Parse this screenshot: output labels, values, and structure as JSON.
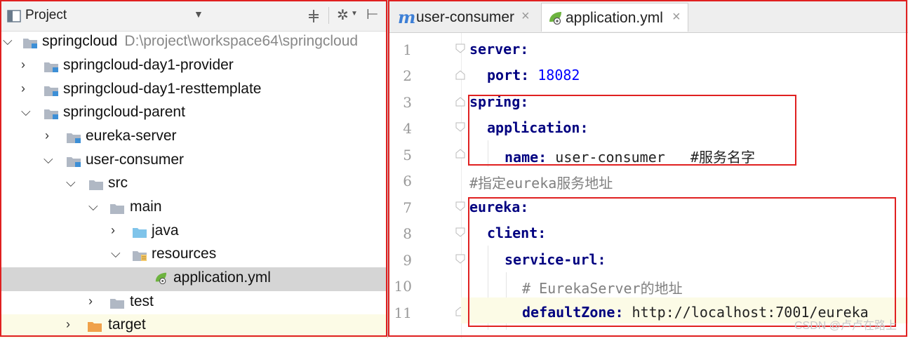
{
  "project_panel": {
    "title": "Project",
    "tree": [
      {
        "label": "springcloud",
        "path": "D:\\project\\workspace64\\springcloud",
        "expanded": true,
        "icon": "module-folder-icon"
      },
      {
        "label": "springcloud-day1-provider",
        "expanded": false,
        "icon": "module-folder-icon"
      },
      {
        "label": "springcloud-day1-resttemplate",
        "expanded": false,
        "icon": "module-folder-icon"
      },
      {
        "label": "springcloud-parent",
        "expanded": true,
        "icon": "module-folder-icon"
      },
      {
        "label": "eureka-server",
        "expanded": false,
        "icon": "module-folder-icon"
      },
      {
        "label": "user-consumer",
        "expanded": true,
        "icon": "module-folder-icon"
      },
      {
        "label": "src",
        "expanded": true,
        "icon": "folder-icon"
      },
      {
        "label": "main",
        "expanded": true,
        "icon": "folder-icon"
      },
      {
        "label": "java",
        "expanded": false,
        "icon": "source-folder-icon"
      },
      {
        "label": "resources",
        "expanded": true,
        "icon": "resources-folder-icon"
      },
      {
        "label": "application.yml",
        "selected": true,
        "icon": "spring-yml-icon"
      },
      {
        "label": "test",
        "expanded": false,
        "icon": "folder-icon"
      },
      {
        "label": "target",
        "expanded": false,
        "icon": "excluded-folder-icon"
      }
    ]
  },
  "editor": {
    "tabs": [
      {
        "label": "user-consumer",
        "icon": "m-icon",
        "active": false
      },
      {
        "label": "application.yml",
        "icon": "spring-yml-icon",
        "active": true
      }
    ],
    "line_numbers": [
      "1",
      "2",
      "3",
      "4",
      "5",
      "6",
      "7",
      "8",
      "9",
      "10",
      "11"
    ],
    "lines": [
      {
        "key": "server:",
        "rest": ""
      },
      {
        "key": "port:",
        "rest": " 18082"
      },
      {
        "key": "spring:",
        "rest": ""
      },
      {
        "key": "application:",
        "rest": ""
      },
      {
        "key": "name:",
        "rest": " user-consumer   #服务名字"
      },
      {
        "key": "",
        "rest": "#指定eureka服务地址"
      },
      {
        "key": "eureka:",
        "rest": ""
      },
      {
        "key": "client:",
        "rest": ""
      },
      {
        "key": "service-url:",
        "rest": ""
      },
      {
        "key": "",
        "rest": "# EurekaServer的地址"
      },
      {
        "key": "defaultZone:",
        "rest": " http://localhost:7001/eureka"
      }
    ]
  },
  "watermark": "CSDN @卢卢在路上",
  "colors": {
    "highlight_frame": "#e02020",
    "yaml_key": "#000080",
    "number": "#0000ff",
    "comment": "#808080"
  }
}
